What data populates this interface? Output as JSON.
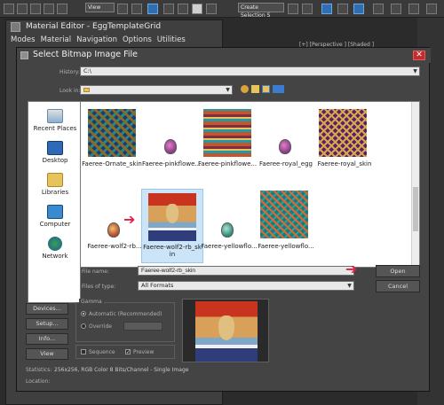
{
  "max": {
    "view_combo": "View",
    "selection_combo": "Create Selection S",
    "viewport_label": "[+] [Perspective ] [Shaded ]"
  },
  "material_editor": {
    "title": "Material Editor - EggTemplateGrid",
    "menu": [
      "Modes",
      "Material",
      "Navigation",
      "Options",
      "Utilities"
    ]
  },
  "dialog": {
    "title": "Select Bitmap Image File",
    "close_glyph": "✕",
    "history_label": "History:",
    "history_value": "C:\\",
    "lookin_label": "Look in:",
    "lookin_value": "",
    "places": [
      {
        "label": "Recent Places",
        "icon": "recent-places-icon"
      },
      {
        "label": "Desktop",
        "icon": "desktop-icon"
      },
      {
        "label": "Libraries",
        "icon": "libraries-icon"
      },
      {
        "label": "Computer",
        "icon": "computer-icon"
      },
      {
        "label": "Network",
        "icon": "network-icon"
      }
    ],
    "files": [
      {
        "name": "Faeree-Ornate_skin",
        "kind": "texture",
        "pattern": "tex-a"
      },
      {
        "name": "Faeree-pinkflowe...",
        "kind": "egg",
        "egg": "purple"
      },
      {
        "name": "Faeree-pinkflowe...",
        "kind": "texture",
        "pattern": "tex-b"
      },
      {
        "name": "Faeree-royal_egg",
        "kind": "egg",
        "egg": "purple"
      },
      {
        "name": "Faeree-royal_skin",
        "kind": "texture",
        "pattern": "tex-c"
      },
      {
        "name": "Faeree-wolf2-rb...",
        "kind": "egg",
        "egg": "orange"
      },
      {
        "name": "Faeree-wolf2-rb_sk",
        "name2": "in",
        "kind": "texture",
        "pattern": "tex-wolf",
        "selected": true
      },
      {
        "name": "Faeree-yellowflo...",
        "kind": "egg",
        "egg": "green"
      },
      {
        "name": "Faeree-yellowflo...",
        "kind": "texture",
        "pattern": "tex-d"
      }
    ],
    "filename_label": "File name:",
    "filename_value": "Faeree-wolf2-rb_skin",
    "filetype_label": "Files of type:",
    "filetype_value": "All Formats",
    "open_button": "Open",
    "cancel_button": "Cancel",
    "devices_button": "Devices...",
    "setup_button": "Setup...",
    "info_button": "Info...",
    "view_button": "View",
    "gamma": {
      "title": "Gamma",
      "automatic_label": "Automatic (Recommended)",
      "override_label": "Override",
      "override_value": "",
      "selected": "automatic"
    },
    "sequence_label": "Sequence",
    "sequence_checked": false,
    "preview_label": "Preview",
    "preview_checked": true,
    "statistics_label": "Statistics:",
    "statistics_value": "256x256, RGB Color 8 Bits/Channel - Single Image",
    "location_label": "Location:",
    "location_value": ""
  }
}
